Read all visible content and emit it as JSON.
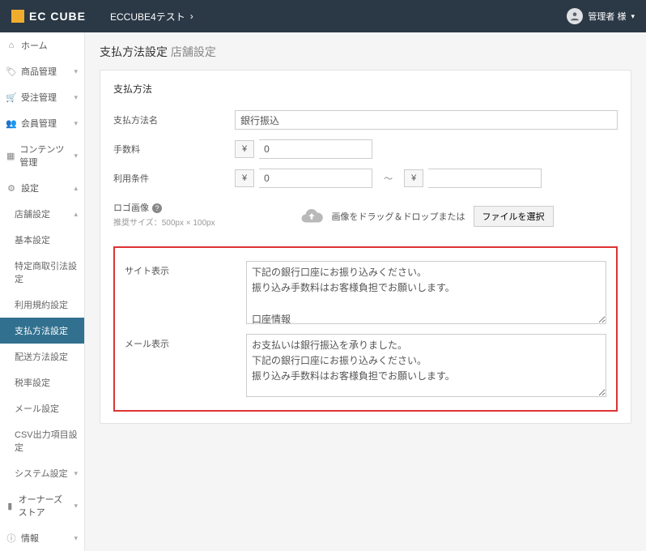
{
  "brand": "EC CUBE",
  "site_name": "ECCUBE4テスト",
  "user_name": "管理者 様",
  "page": {
    "title": "支払方法設定",
    "subtitle": "店舗設定"
  },
  "nav": {
    "home": "ホーム",
    "product": "商品管理",
    "order": "受注管理",
    "member": "会員管理",
    "content": "コンテンツ管理",
    "setting": "設定",
    "shop": {
      "label": "店舗設定",
      "items": {
        "basic": "基本設定",
        "tradelaw": "特定商取引法設定",
        "agreement": "利用規約設定",
        "payment": "支払方法設定",
        "delivery": "配送方法設定",
        "tax": "税率設定",
        "mail": "メール設定",
        "csv": "CSV出力項目設定"
      }
    },
    "system": "システム設定",
    "owners": "オーナーズストア",
    "info": "情報"
  },
  "card": {
    "heading": "支払方法",
    "name_label": "支払方法名",
    "name_value": "銀行振込",
    "fee_label": "手数料",
    "fee_value": "0",
    "cond_label": "利用条件",
    "cond_from": "0",
    "cond_to": "",
    "logo_label": "ロゴ画像",
    "logo_hint": "推奨サイズ：500px × 100px",
    "upload_text": "画像をドラッグ＆ドロップまたは",
    "upload_btn": "ファイルを選択",
    "site_label": "サイト表示",
    "site_text": "下記の銀行口座にお振り込みください。\n振り込み手数料はお客様負担でお願いします。\n\n口座情報\n******************\n○○銀行　○○支店",
    "mail_label": "メール表示",
    "mail_text": "お支払いは銀行振込を承りました。\n下記の銀行口座にお振り込みください。\n振り込み手数料はお客様負担でお願いします。\n\n口座情報\n******************",
    "yen": "¥"
  }
}
